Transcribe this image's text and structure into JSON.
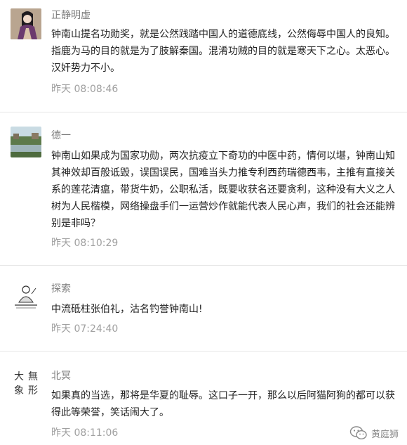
{
  "comments": [
    {
      "user": "正静明虚",
      "text": "钟南山提名功勋奖，就是公然践踏中国人的道德底线，公然侮辱中国人的良知。指鹿为马的目的就是为了肢解秦国。混淆功贼的目的就是寒天下之心。太恶心。汉奸势力不小。",
      "time": "昨天 08:08:46"
    },
    {
      "user": "德一",
      "text": "钟南山如果成为国家功勋，两次抗疫立下奇功的中医中药，情何以堪，钟南山知其神效却百般诋毁，误国误民，国难当头力推专利西药瑞德西韦，主推有直接关系的莲花清瘟，带货牛奶，公职私活，既要收获名还要贪利，这种没有大义之人树为人民楷模，网络操盘手们一运营炒作就能代表人民心声，我们的社会还能辨别是非吗？",
      "time": "昨天 08:10:29"
    },
    {
      "user": "探索",
      "text": "中流砥柱张伯礼，沽名钓誉钟南山!",
      "time": "昨天 07:24:40"
    },
    {
      "user": "北冥",
      "text": "如果真的当选，那将是华夏的耻辱。这口子一开，那么以后阿猫阿狗的都可以获得此等荣誉，笑话闹大了。",
      "time": "昨天 08:11:06"
    }
  ],
  "watermark": {
    "label": "黄庭狮",
    "icon": "wechat-icon"
  },
  "avatar_calligraphy": [
    "大",
    "象",
    "無",
    "形"
  ]
}
